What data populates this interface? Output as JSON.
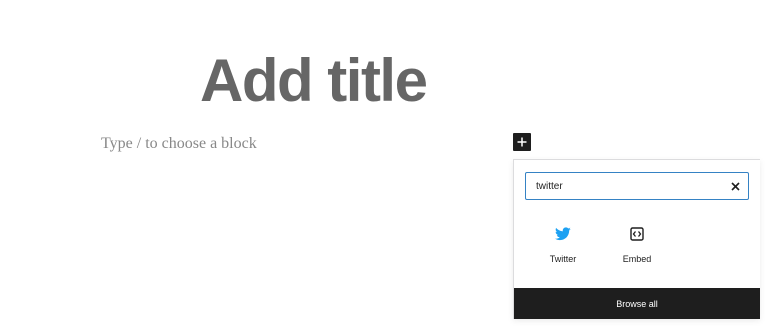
{
  "editor": {
    "title_placeholder": "Add title",
    "block_placeholder": "Type / to choose a block"
  },
  "inserter": {
    "toggle_icon": "plus-icon",
    "search": {
      "value": "twitter"
    },
    "clear_icon": "close-icon",
    "results": [
      {
        "label": "Twitter",
        "icon": "twitter-icon",
        "icon_color": "#1da1f2"
      },
      {
        "label": "Embed",
        "icon": "embed-icon",
        "icon_color": "#1e1e1e"
      }
    ],
    "browse_all_label": "Browse all"
  },
  "colors": {
    "accent": "#3582c4",
    "dark": "#1e1e1e",
    "title_text": "#666666",
    "placeholder_text": "#888888"
  }
}
